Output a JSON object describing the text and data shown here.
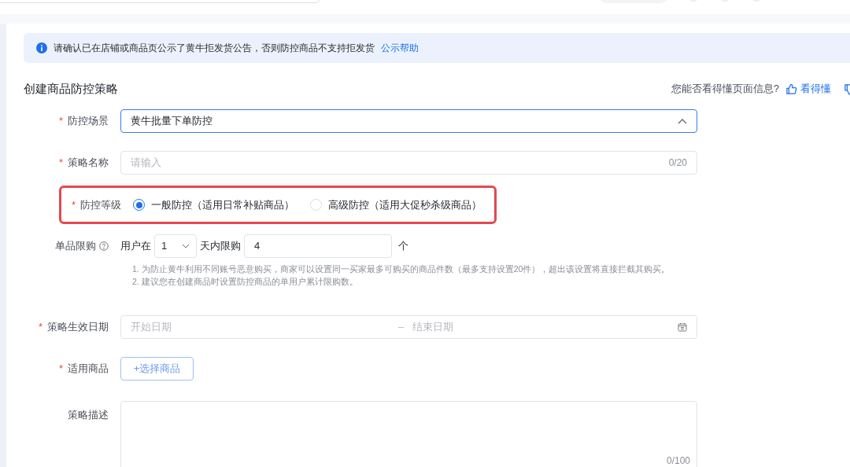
{
  "notice": {
    "text": "请确认已在店铺或商品页公示了黄牛拒发货公告，否则防控商品不支持拒发货",
    "link": "公示帮助"
  },
  "title": "创建商品防控策略",
  "feedback": {
    "question": "您能否看得懂页面信息?",
    "yes": "看得懂"
  },
  "form": {
    "scene": {
      "label": "防控场景",
      "required_mark": "*",
      "value": "黄牛批量下单防控",
      "expanded": true
    },
    "name": {
      "label": "策略名称",
      "required_mark": "*",
      "placeholder": "请输入",
      "counter": "0/20"
    },
    "level": {
      "label": "防控等级",
      "required_mark": "*",
      "highlighted": true,
      "options": [
        {
          "label": "一般防控（适用日常补贴商品）",
          "selected": true
        },
        {
          "label": "高级防控（适用大促秒杀级商品）",
          "selected": false
        }
      ]
    },
    "limit": {
      "label": "单品限购",
      "prefix": "用户在",
      "days": "1",
      "middle": "天内限购",
      "count": "4",
      "unit": "个",
      "help": [
        "1. 为防止黄牛利用不同账号恶意购买，商家可以设置同一买家最多可购买的商品件数（最多支持设置20件），超出该设置将直接拦截其购买。",
        "2. 建议您在创建商品时设置防控商品的单用户累计限购数。"
      ]
    },
    "date": {
      "label": "策略生效日期",
      "required_mark": "*",
      "start_placeholder": "开始日期",
      "separator": "–",
      "end_placeholder": "结束日期"
    },
    "products": {
      "label": "适用商品",
      "required_mark": "*",
      "button": "+选择商品"
    },
    "description": {
      "label": "策略描述",
      "counter": "0/100"
    }
  }
}
